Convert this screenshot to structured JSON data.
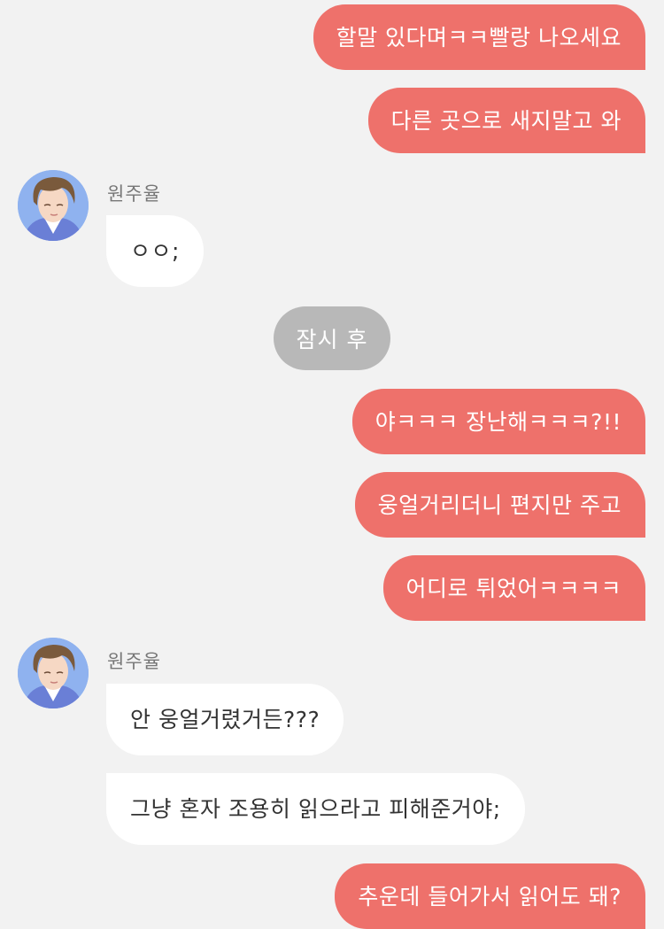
{
  "messages": {
    "m1": "할말 있다며ㅋㅋ빨랑 나오세요",
    "m2": "다른 곳으로 새지말고 와",
    "m3": "ㅇㅇ;",
    "system": "잠시 후",
    "m4": "야ㅋㅋㅋ 장난해ㅋㅋㅋ?!!",
    "m5": "웅얼거리더니 편지만 주고",
    "m6": "어디로 튀었어ㅋㅋㅋㅋ",
    "m7": "안 웅얼거렸거든???",
    "m8": "그냥 혼자 조용히 읽으라고 피해준거야;",
    "m9": "추운데 들어가서 읽어도 돼?"
  },
  "contact": {
    "name": "원주율"
  },
  "colors": {
    "background": "#f2f2f2",
    "my_bubble": "#ee716b",
    "their_bubble": "#ffffff",
    "system_bubble": "#b8b8b8",
    "name_text": "#777777"
  },
  "icons": {
    "avatar": "boy-with-brown-hair-avatar"
  }
}
